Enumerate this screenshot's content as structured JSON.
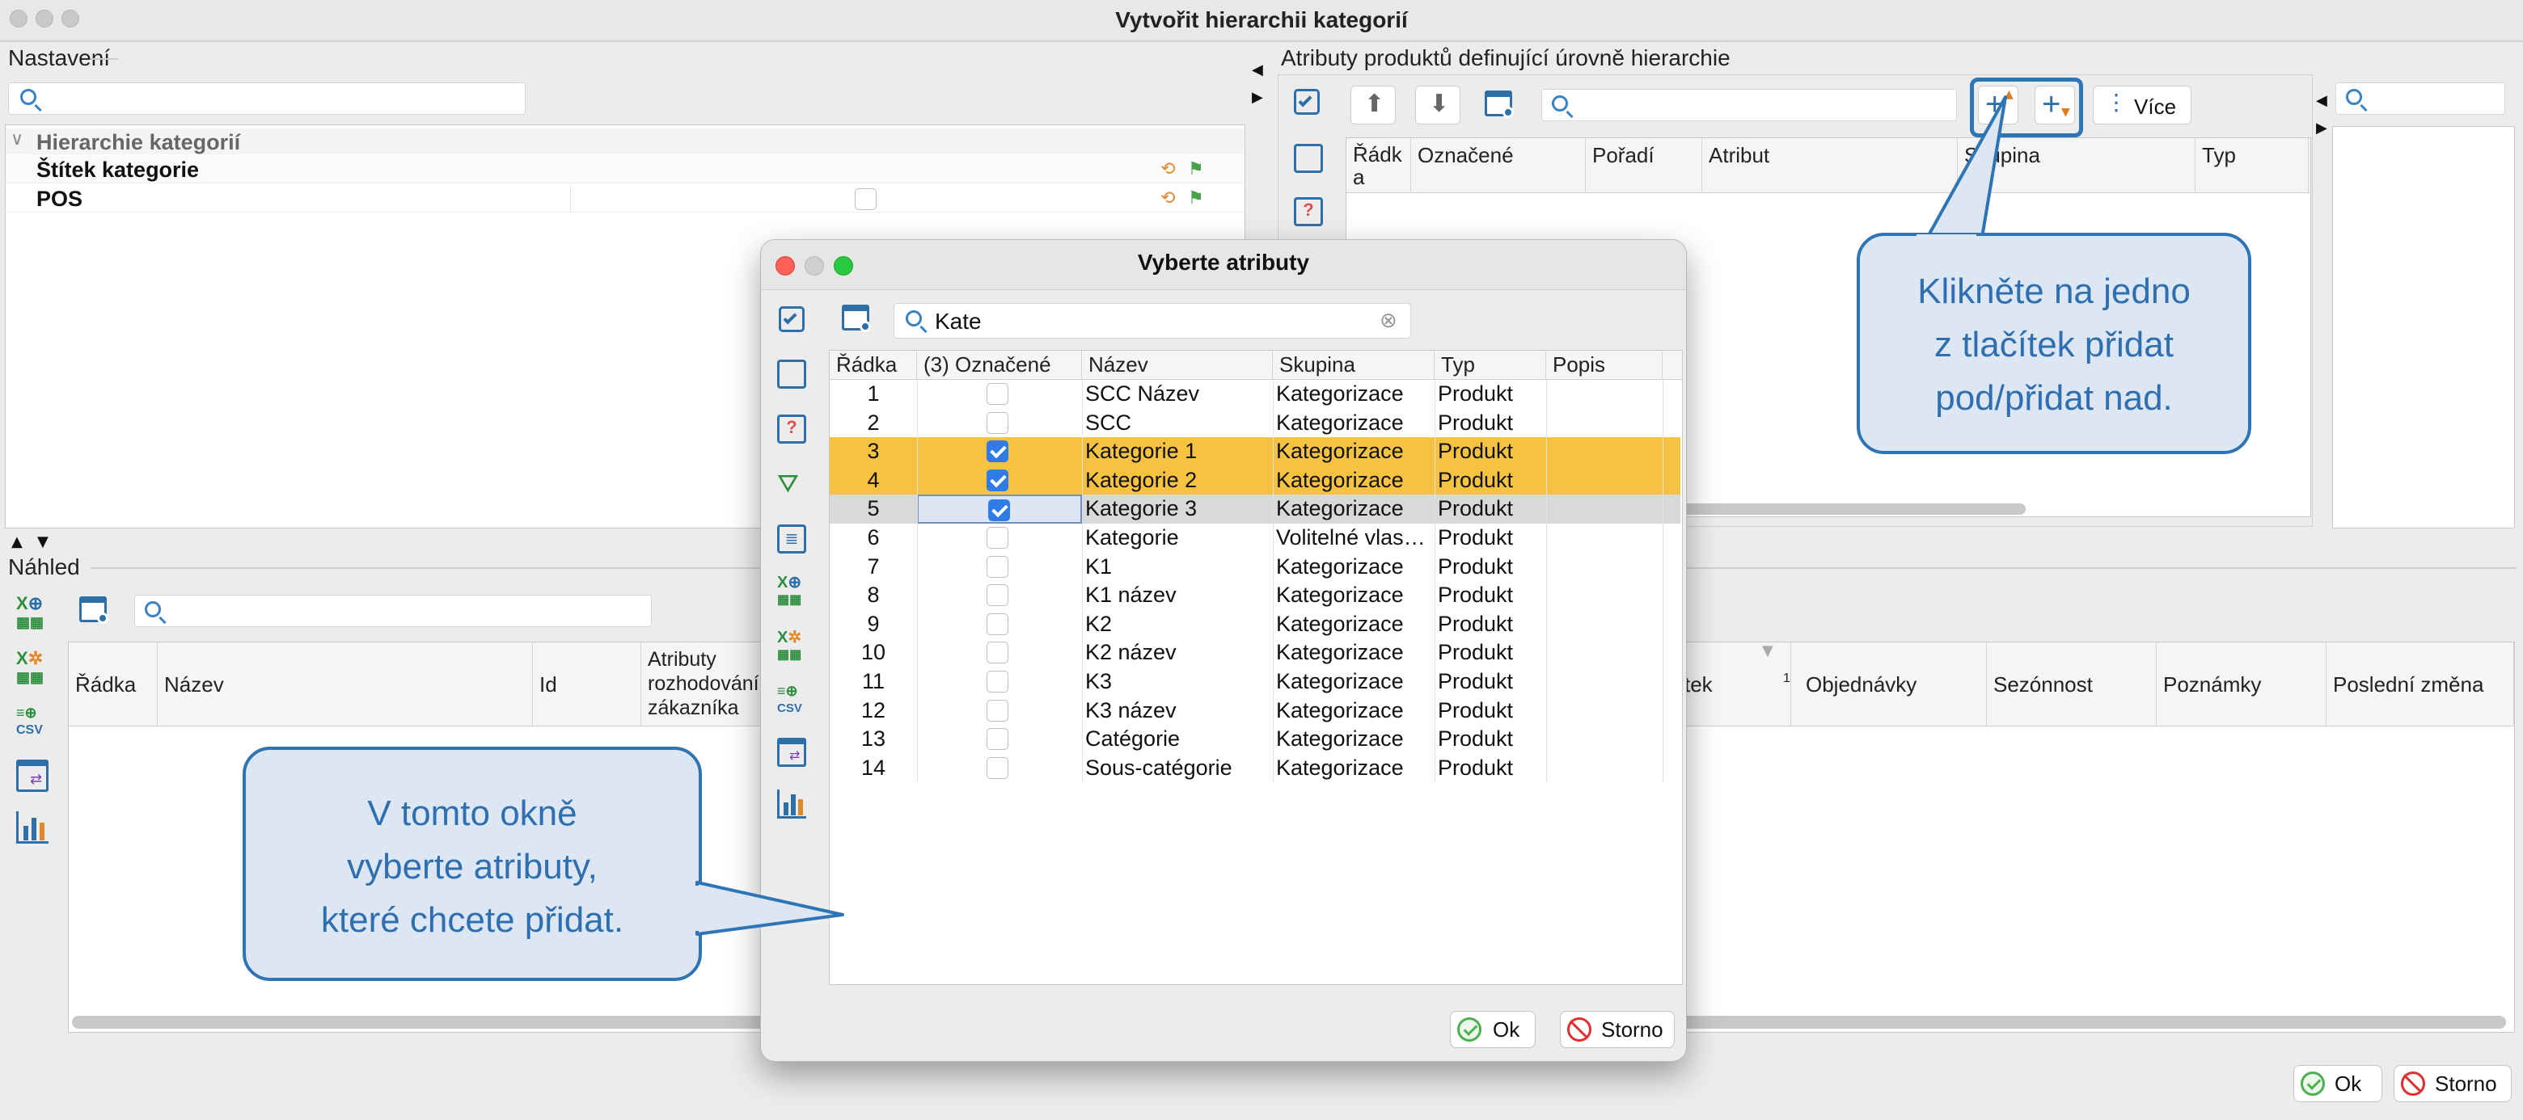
{
  "window": {
    "title": "Vytvořit hierarchii kategorií"
  },
  "settings": {
    "label": "Nastavení",
    "tree_group": "Hierarchie kategorií",
    "items": [
      "Štítek kategorie",
      "POS"
    ]
  },
  "attrs_panel": {
    "label": "Atributy produktů definující úrovně hierarchie",
    "more_label": "Více",
    "columns": [
      "Řádk\na",
      "Označené",
      "Pořadí",
      "Atribut",
      "Skupina",
      "Typ"
    ]
  },
  "preview": {
    "label": "Náhled",
    "columns": [
      "Řádka",
      "Název",
      "Id",
      "Atributy\nrozhodování\nzákazníka",
      "tek",
      "Objednávky",
      "Sezónnost",
      "Poznámky",
      "Poslední změna"
    ],
    "sort_badge": "1"
  },
  "dialog": {
    "title": "Vyberte atributy",
    "search_value": "Kate",
    "columns": [
      "Řádka",
      "(3) Označené",
      "Název",
      "Skupina",
      "Typ",
      "Popis"
    ],
    "rows": [
      {
        "n": "1",
        "checked": false,
        "name": "SCC Název",
        "group": "Kategorizace",
        "type": "Produkt",
        "state": "normal"
      },
      {
        "n": "2",
        "checked": false,
        "name": "SCC",
        "group": "Kategorizace",
        "type": "Produkt",
        "state": "normal"
      },
      {
        "n": "3",
        "checked": true,
        "name": "Kategorie 1",
        "group": "Kategorizace",
        "type": "Produkt",
        "state": "selected"
      },
      {
        "n": "4",
        "checked": true,
        "name": "Kategorie 2",
        "group": "Kategorizace",
        "type": "Produkt",
        "state": "selected"
      },
      {
        "n": "5",
        "checked": true,
        "name": "Kategorie 3",
        "group": "Kategorizace",
        "type": "Produkt",
        "state": "focused"
      },
      {
        "n": "6",
        "checked": false,
        "name": "Kategorie",
        "group": "Volitelné vlas…",
        "type": "Produkt",
        "state": "normal"
      },
      {
        "n": "7",
        "checked": false,
        "name": "K1",
        "group": "Kategorizace",
        "type": "Produkt",
        "state": "normal"
      },
      {
        "n": "8",
        "checked": false,
        "name": "K1 název",
        "group": "Kategorizace",
        "type": "Produkt",
        "state": "normal"
      },
      {
        "n": "9",
        "checked": false,
        "name": "K2",
        "group": "Kategorizace",
        "type": "Produkt",
        "state": "normal"
      },
      {
        "n": "10",
        "checked": false,
        "name": "K2 název",
        "group": "Kategorizace",
        "type": "Produkt",
        "state": "normal"
      },
      {
        "n": "11",
        "checked": false,
        "name": "K3",
        "group": "Kategorizace",
        "type": "Produkt",
        "state": "normal"
      },
      {
        "n": "12",
        "checked": false,
        "name": "K3 název",
        "group": "Kategorizace",
        "type": "Produkt",
        "state": "normal"
      },
      {
        "n": "13",
        "checked": false,
        "name": "Catégorie",
        "group": "Kategorizace",
        "type": "Produkt",
        "state": "normal"
      },
      {
        "n": "14",
        "checked": false,
        "name": "Sous-catégorie",
        "group": "Kategorizace",
        "type": "Produkt",
        "state": "normal"
      }
    ],
    "ok_label": "Ok",
    "cancel_label": "Storno"
  },
  "footer": {
    "ok_label": "Ok",
    "cancel_label": "Storno"
  },
  "callouts": {
    "top": "Klikněte na jedno\nz tlačítek přidat\npod/přidat nad.",
    "bottom": "V tomto okně\nvyberte atributy,\nkteré chcete přidat."
  },
  "colors": {
    "selected_row": "#f5c242",
    "focused_row": "#d9d9d9",
    "accent": "#2f74b5",
    "callout_bg": "#dce7f3"
  }
}
